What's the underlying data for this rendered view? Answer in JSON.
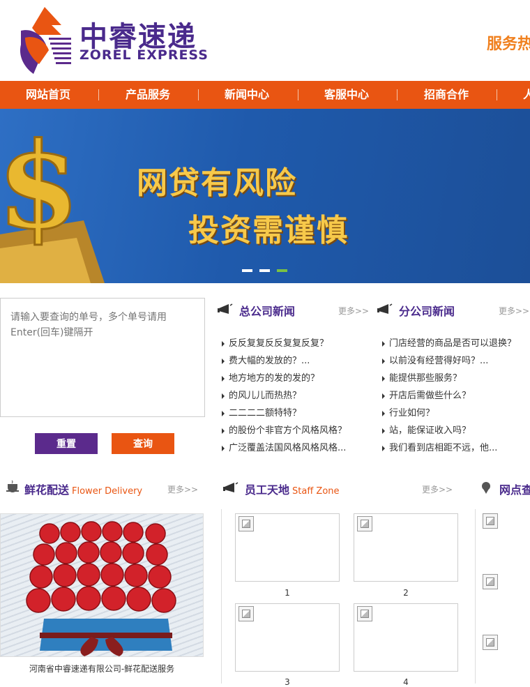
{
  "header": {
    "logo_cn": "中睿速递",
    "logo_en": "ZOREL EXPRESS",
    "hotline": "服务热"
  },
  "nav": {
    "items": [
      "网站首页",
      "产品服务",
      "新闻中心",
      "客服中心",
      "招商合作",
      "人"
    ]
  },
  "banner": {
    "line1": "网贷有风险",
    "line2": "投资需谨慎",
    "slides": 3,
    "active_slide": 3
  },
  "query": {
    "placeholder": "请输入要查询的单号，多个单号请用Enter(回车)键隔开",
    "reset_label": "重置",
    "query_label": "查询"
  },
  "hq_news": {
    "title": "总公司新闻",
    "more": "更多>>",
    "items": [
      "反反复复反反复复反复？",
      "费大幅的发放的？...",
      "地方地方的发的发的？",
      "的风儿儿而热热？",
      "二二二二额特特？",
      "的股份个非官方个风格风格？",
      "广泛覆盖法国风格风格风格..."
    ]
  },
  "branch_news": {
    "title": "分公司新闻",
    "more": "更多>>",
    "items": [
      "门店经营的商品是否可以退换？",
      "以前没有经营得好吗？...",
      "能提供那些服务？",
      "开店后需做些什么？",
      "行业如何？",
      "站，能保证收入吗？",
      "我们看到店相距不远，他..."
    ]
  },
  "flowers": {
    "title": "鲜花配送",
    "subtitle": "Flower Delivery",
    "more": "更多>>",
    "caption": "河南省中睿速递有限公司-鲜花配送服务"
  },
  "staff": {
    "title": "员工天地",
    "subtitle": "Staff Zone",
    "more": "更多>>",
    "photos": [
      "1",
      "2",
      "3",
      "4"
    ]
  },
  "outlets": {
    "title": "网点查"
  },
  "colors": {
    "brand_orange": "#e95512",
    "brand_purple": "#4a2a8c",
    "banner_blue": "#1f5aac",
    "active_dot": "#7ac143"
  }
}
